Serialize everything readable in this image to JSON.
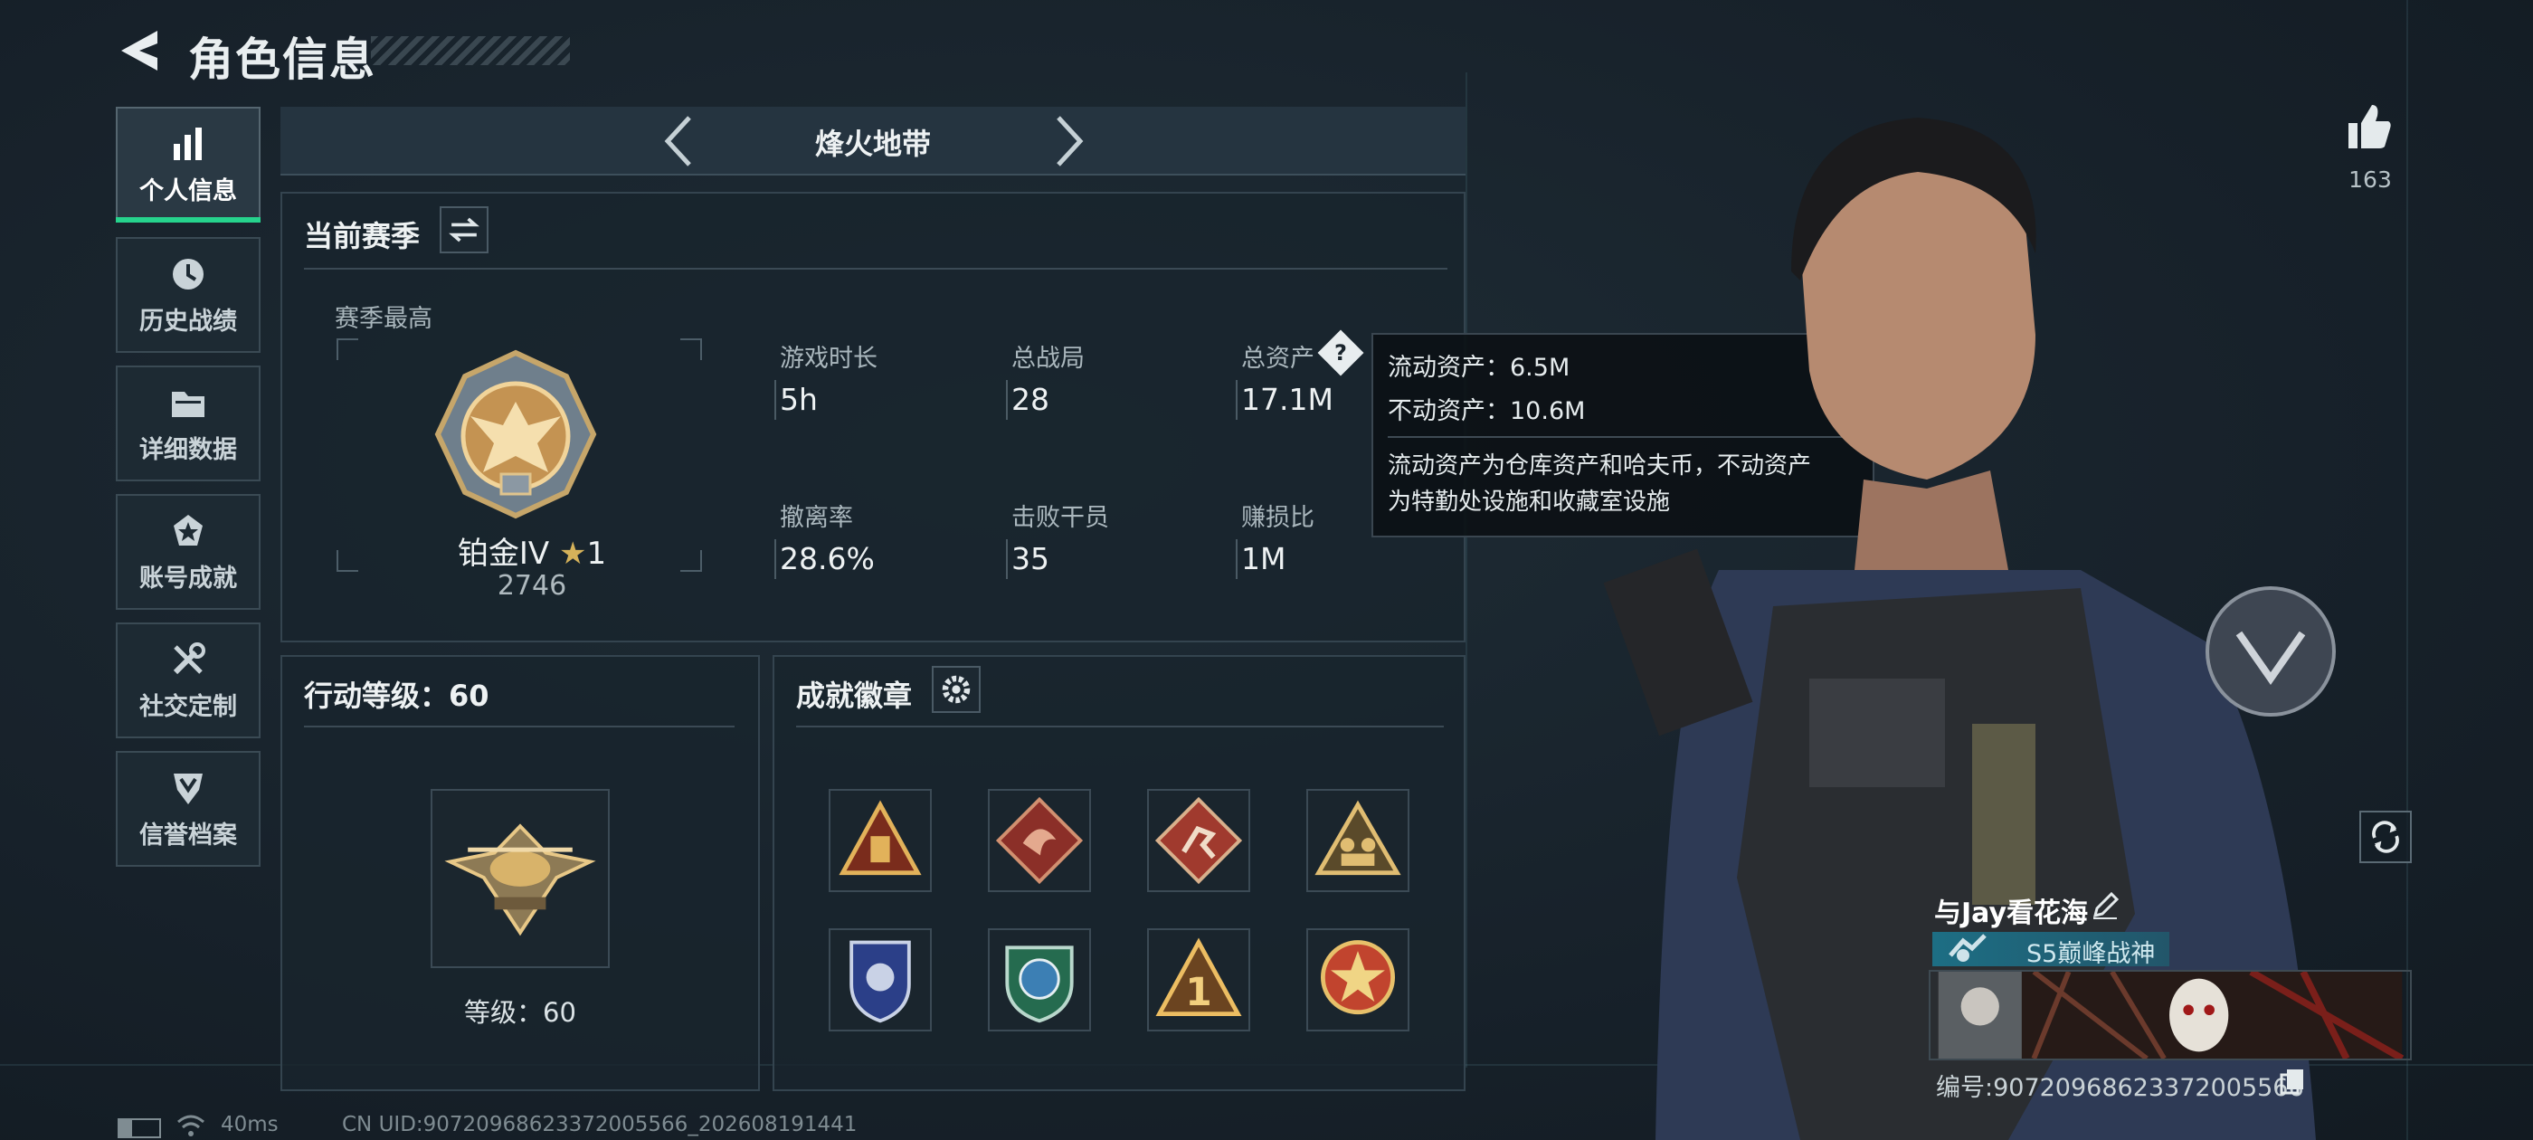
{
  "header": {
    "title": "角色信息"
  },
  "sidebar": {
    "items": [
      {
        "label": "个人信息",
        "icon": "bar-chart-icon",
        "active": true
      },
      {
        "label": "历史战绩",
        "icon": "history-clock-icon"
      },
      {
        "label": "详细数据",
        "icon": "folder-icon"
      },
      {
        "label": "账号成就",
        "icon": "achievement-star-icon"
      },
      {
        "label": "社交定制",
        "icon": "wrench-tools-icon"
      },
      {
        "label": "信誉档案",
        "icon": "shield-emblem-icon"
      }
    ]
  },
  "mode": {
    "name": "烽火地带"
  },
  "season": {
    "title": "当前赛季",
    "best_label": "赛季最高",
    "rank_name": "铂金IV",
    "rank_star": "1",
    "rank_score": "2746",
    "stats": [
      {
        "label": "游戏时长",
        "value": "5h"
      },
      {
        "label": "总战局",
        "value": "28"
      },
      {
        "label": "总资产",
        "value": "17.1M"
      },
      {
        "label": "撤离率",
        "value": "28.6%"
      },
      {
        "label": "击败干员",
        "value": "35"
      },
      {
        "label": "赚损比",
        "value": "1M"
      }
    ]
  },
  "tooltip": {
    "liquid": "流动资产：6.5M",
    "fixed": "不动资产：10.6M",
    "desc1": "流动资产为仓库资产和哈夫币，不动资产",
    "desc2": "为特勤处设施和收藏室设施"
  },
  "action_level": {
    "title": "行动等级：60",
    "level_text": "等级：60"
  },
  "achievements": {
    "title": "成就徽章",
    "badges": [
      "triangle-crate-badge",
      "dragon-diamond-badge",
      "runner-diamond-badge",
      "squad-triangle-badge",
      "police-shield-badge",
      "globe-shield-badge",
      "number-one-triangle-badge",
      "star-medal-badge"
    ]
  },
  "profile": {
    "likes": "163",
    "player_name": "与Jay看花海",
    "player_title": "S5巅峰战神",
    "id_text": "编号:90720968623372005566"
  },
  "status": {
    "ping": "40ms",
    "uid": "CN UID:90720968623372005566_202608191441"
  },
  "colors": {
    "accent": "#26d38d",
    "background": "#17222b",
    "panel_border": "#34444f"
  }
}
